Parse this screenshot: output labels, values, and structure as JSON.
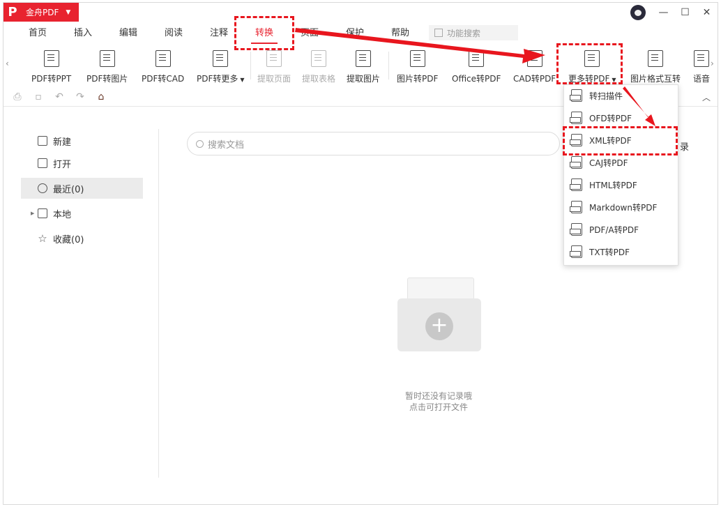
{
  "app": {
    "name": "金舟PDF",
    "logo": "P"
  },
  "menu": [
    "首页",
    "插入",
    "编辑",
    "阅读",
    "注释",
    "转换",
    "页面",
    "保护",
    "帮助"
  ],
  "active_menu": "转换",
  "function_search": {
    "placeholder": "功能搜索"
  },
  "ribbon": {
    "tools": [
      {
        "label": "PDF转PPT",
        "icon": "pdf-to-ppt-icon"
      },
      {
        "label": "PDF转图片",
        "icon": "pdf-to-image-icon"
      },
      {
        "label": "PDF转CAD",
        "icon": "pdf-to-cad-icon"
      },
      {
        "label": "PDF转更多",
        "icon": "pdf-to-more-icon"
      },
      {
        "label": "提取页面",
        "icon": "extract-page-icon"
      },
      {
        "label": "提取表格",
        "icon": "extract-table-icon"
      },
      {
        "label": "提取图片",
        "icon": "extract-image-icon"
      },
      {
        "label": "图片转PDF",
        "icon": "image-to-pdf-icon"
      },
      {
        "label": "Office转PDF",
        "icon": "office-to-pdf-icon"
      },
      {
        "label": "CAD转PDF",
        "icon": "cad-to-pdf-icon"
      },
      {
        "label": "更多转PDF",
        "icon": "more-to-pdf-icon"
      },
      {
        "label": "图片格式互转",
        "icon": "image-format-convert-icon"
      },
      {
        "label": "语音",
        "icon": "voice-icon"
      }
    ]
  },
  "sidebar": {
    "items": [
      {
        "label": "新建",
        "icon": "new-file-icon"
      },
      {
        "label": "打开",
        "icon": "open-file-icon"
      },
      {
        "label": "最近(0)",
        "icon": "clock-icon"
      },
      {
        "label": "本地",
        "icon": "computer-icon"
      },
      {
        "label": "收藏(0)",
        "icon": "star-icon"
      }
    ]
  },
  "doc_search": {
    "placeholder": "搜索文档"
  },
  "partial_text": "录",
  "empty": {
    "line1": "暂时还没有记录哦",
    "line2": "点击可打开文件"
  },
  "dropdown": {
    "items": [
      "转扫描件",
      "OFD转PDF",
      "XML转PDF",
      "CAJ转PDF",
      "HTML转PDF",
      "Markdown转PDF",
      "PDF/A转PDF",
      "TXT转PDF"
    ]
  },
  "colors": {
    "brand": "#e8232f",
    "highlight": "#e8161e"
  }
}
